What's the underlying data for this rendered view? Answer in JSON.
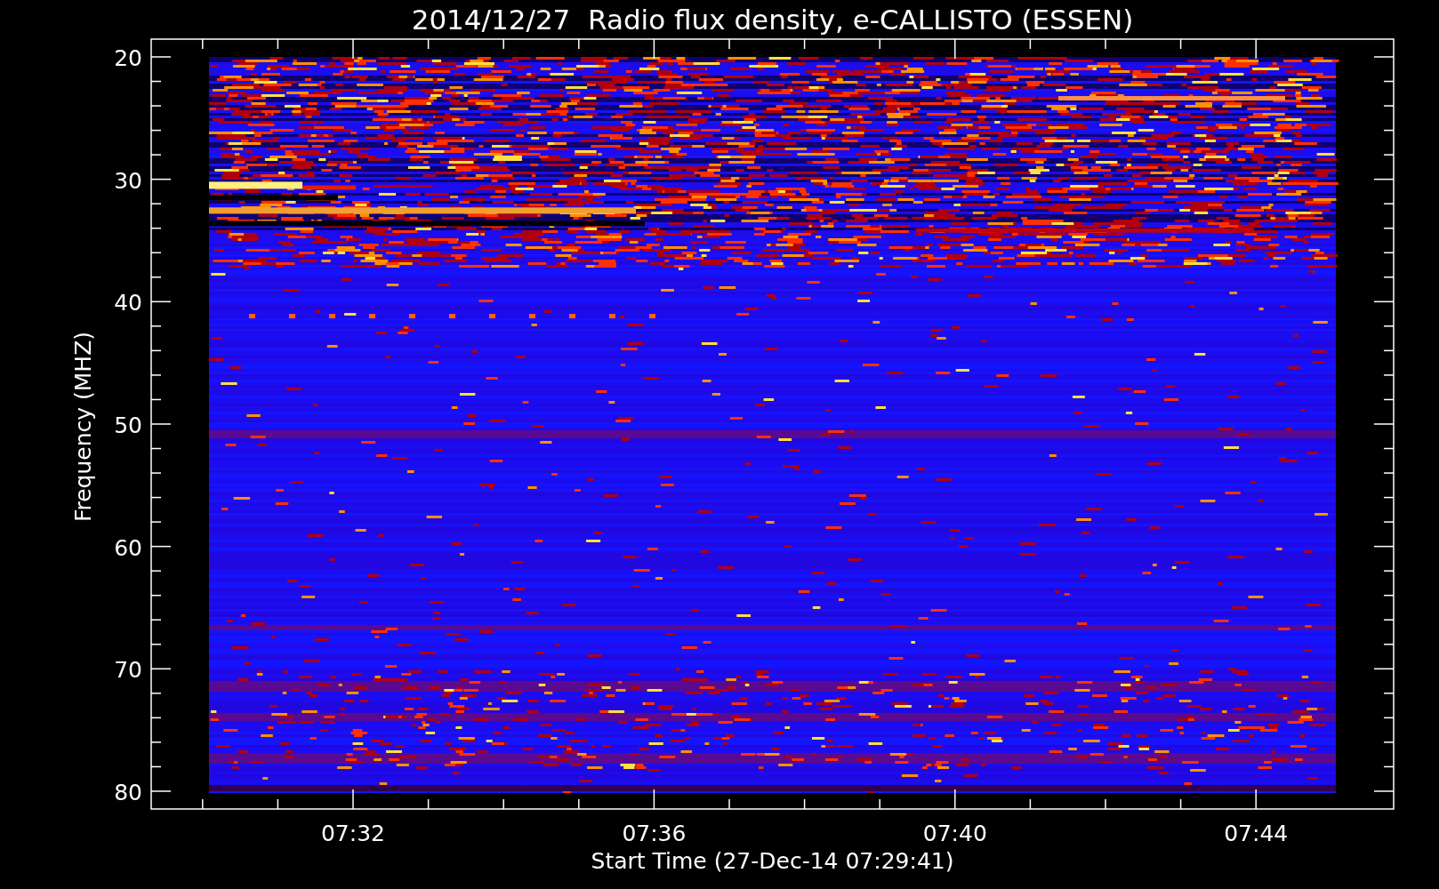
{
  "title": "2014/12/27  Radio flux density, e-CALLISTO (ESSEN)",
  "y_axis": {
    "label": "Frequency (MHZ)",
    "ticks": [
      "20",
      "30",
      "40",
      "50",
      "60",
      "70",
      "80"
    ]
  },
  "x_axis": {
    "label": "Start Time (27-Dec-14 07:29:41)",
    "ticks": [
      "07:32",
      "07:36",
      "07:40",
      "07:44"
    ]
  }
}
